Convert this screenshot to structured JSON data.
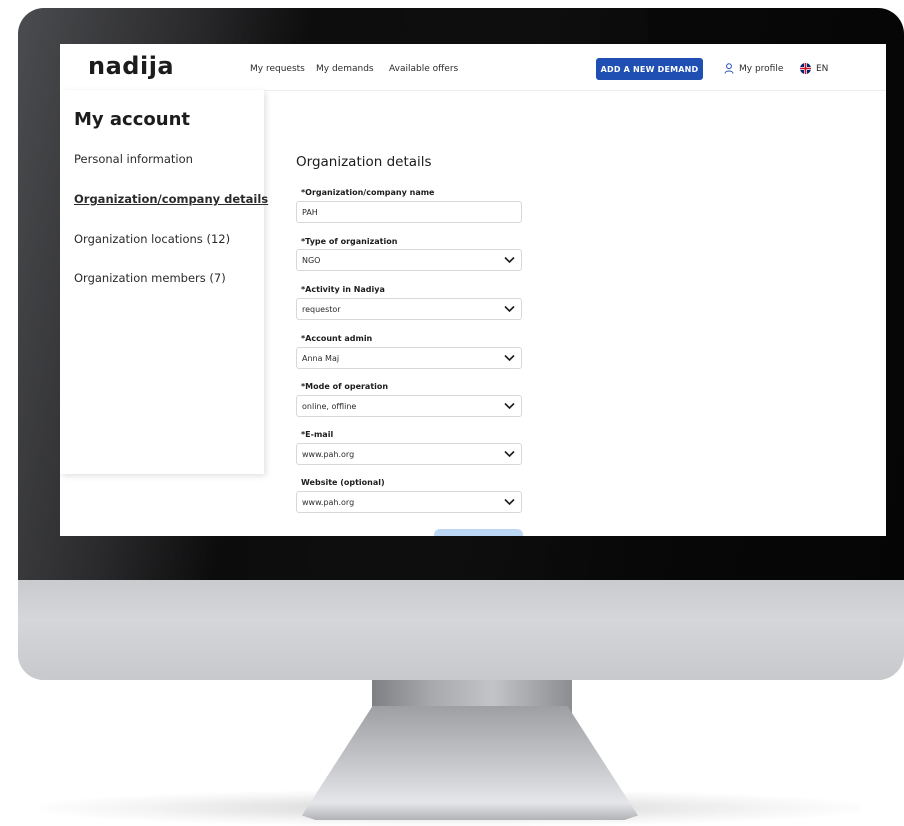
{
  "app": {
    "logo": "nadija",
    "nav": [
      "My requests",
      "My demands",
      "Available offers"
    ],
    "add_button": "ADD A NEW DEMAND",
    "profile": "My profile",
    "language": "EN"
  },
  "sidebar": {
    "title": "My account",
    "items": [
      {
        "label": "Personal information",
        "active": false
      },
      {
        "label": "Organization/company details",
        "active": true
      },
      {
        "label": "Organization locations (12)",
        "active": false
      },
      {
        "label": "Organization members (7)",
        "active": false
      }
    ]
  },
  "form": {
    "title": "Organization details",
    "fields": [
      {
        "label": "*Organization/company name",
        "value": "PAH",
        "dropdown": false
      },
      {
        "label": "*Type of organization",
        "value": "NGO",
        "dropdown": true
      },
      {
        "label": "*Activity in Nadiya",
        "value": "requestor",
        "dropdown": true
      },
      {
        "label": "*Account admin",
        "value": "Anna Maj",
        "dropdown": true
      },
      {
        "label": "*Mode of operation",
        "value": "online, offline",
        "dropdown": true
      },
      {
        "label": "*E-mail",
        "value": "www.pah.org",
        "dropdown": true
      },
      {
        "label": "Website (optional)",
        "value": "www.pah.org",
        "dropdown": true
      }
    ]
  },
  "colors": {
    "accent": "#1f4fb2",
    "save_button": "#bcd6f5",
    "flag_red": "#c8102e",
    "flag_blue": "#012169"
  },
  "icons": [
    "user-icon",
    "uk-flag-icon",
    "chevron-down-icon"
  ]
}
